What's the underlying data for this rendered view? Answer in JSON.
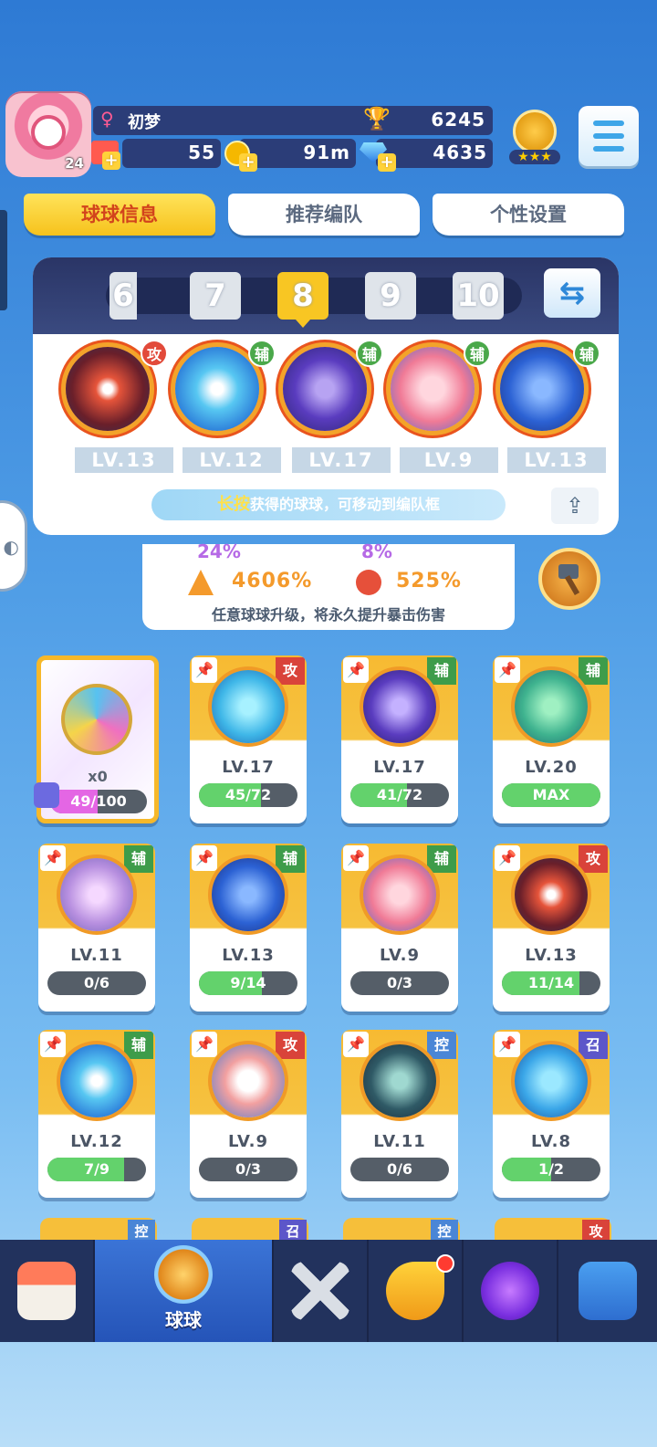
{
  "header": {
    "player_name": "初梦",
    "gender_symbol": "♀",
    "level": "24",
    "trophies": "6245",
    "resource1": "55",
    "gold": "91m",
    "gems": "4635",
    "rank_stars": "★★★"
  },
  "tabs": [
    {
      "label": "球球信息",
      "active": true
    },
    {
      "label": "推荐编队",
      "active": false
    },
    {
      "label": "个性设置",
      "active": false
    }
  ],
  "team_slots": [
    "6",
    "7",
    "8",
    "9",
    "10"
  ],
  "team_selected": "8",
  "team": [
    {
      "type": "攻",
      "level": "LV.13"
    },
    {
      "type": "辅",
      "level": "LV.12"
    },
    {
      "type": "辅",
      "level": "LV.17"
    },
    {
      "type": "辅",
      "level": "LV.9"
    },
    {
      "type": "辅",
      "level": "LV.13"
    }
  ],
  "hint": {
    "highlight": "长按",
    "text": "获得的球球，可移动到编队框"
  },
  "crit": {
    "partial_left": "24%",
    "partial_right": "8%",
    "stat_left": "4606%",
    "stat_right": "525%",
    "desc": "任意球球升级，将永久提升暴击伤害"
  },
  "special_card": {
    "count": "x0",
    "progress_text": "49/100",
    "progress": 0.49
  },
  "balls": [
    {
      "type": "攻",
      "level": "LV.17",
      "progress_text": "45/72",
      "progress": 0.625
    },
    {
      "type": "辅",
      "level": "LV.17",
      "progress_text": "41/72",
      "progress": 0.57
    },
    {
      "type": "辅",
      "level": "LV.20",
      "progress_text": "MAX",
      "progress": 1.0
    },
    {
      "type": "辅",
      "level": "LV.11",
      "progress_text": "0/6",
      "progress": 0.0
    },
    {
      "type": "辅",
      "level": "LV.13",
      "progress_text": "9/14",
      "progress": 0.64
    },
    {
      "type": "辅",
      "level": "LV.9",
      "progress_text": "0/3",
      "progress": 0.0
    },
    {
      "type": "攻",
      "level": "LV.13",
      "progress_text": "11/14",
      "progress": 0.79
    },
    {
      "type": "辅",
      "level": "LV.12",
      "progress_text": "7/9",
      "progress": 0.78
    },
    {
      "type": "攻",
      "level": "LV.9",
      "progress_text": "0/3",
      "progress": 0.0
    },
    {
      "type": "控",
      "level": "LV.11",
      "progress_text": "0/6",
      "progress": 0.0
    },
    {
      "type": "召",
      "level": "LV.8",
      "progress_text": "1/2",
      "progress": 0.5
    }
  ],
  "partial_row_types": [
    "控",
    "召",
    "控",
    "攻"
  ],
  "nav": {
    "selected_label": "球球"
  },
  "icons": {
    "pin": "pin-icon",
    "swap": "swap-icon",
    "share": "share-icon",
    "trophy": "trophy-icon"
  }
}
